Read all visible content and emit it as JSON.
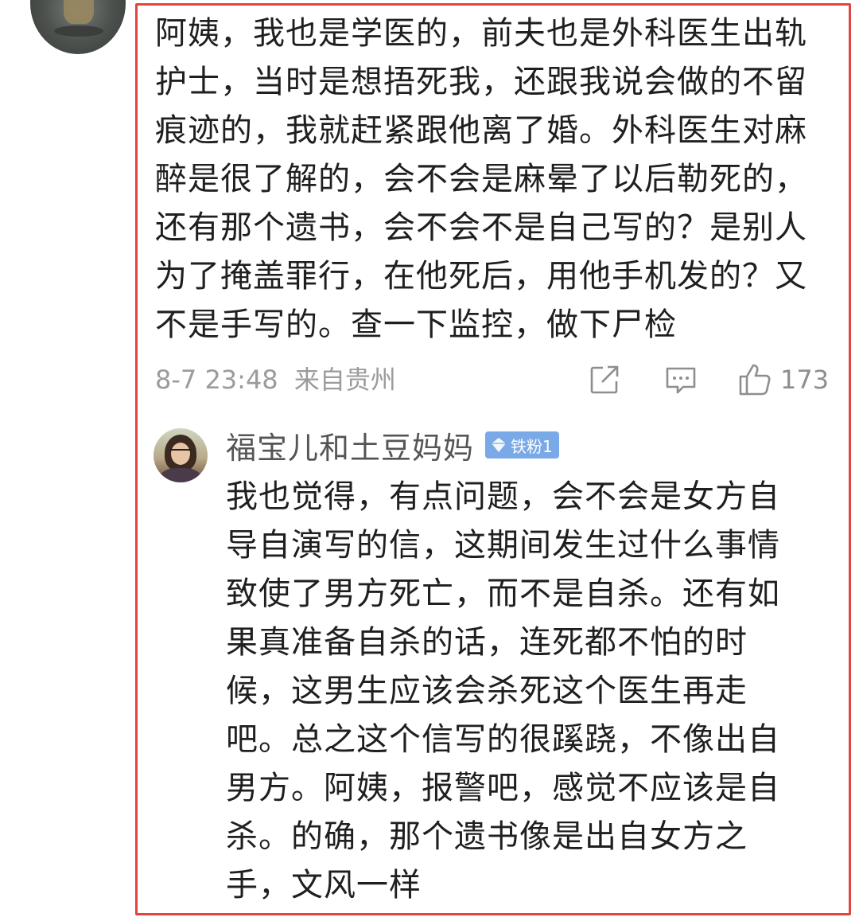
{
  "top_comment": {
    "text": "阿姨，我也是学医的，前夫也是外科医生出轨护士，当时是想捂死我，还跟我说会做的不留痕迹的，我就赶紧跟他离了婚。外科医生对麻醉是很了解的，会不会是麻晕了以后勒死的，还有那个遗书，会不会不是自己写的？是别人为了掩盖罪行，在他死后，用他手机发的？又不是手写的。查一下监控，做下尸检",
    "timestamp": "8-7 23:48",
    "location": "来自贵州",
    "like_count": "173",
    "icons": {
      "share": "share-icon",
      "comment": "comment-icon",
      "like": "thumbs-up-icon"
    }
  },
  "reply": {
    "username": "福宝儿和土豆妈妈",
    "badge": "铁粉1",
    "badge_icon": "diamond-icon",
    "text": "我也觉得，有点问题，会不会是女方自导自演写的信，这期间发生过什么事情致使了男方死亡，而不是自杀。还有如果真准备自杀的话，连死都不怕的时候，这男生应该会杀死这个医生再走吧。总之这个信写的很蹊跷，不像出自男方。阿姨，报警吧，感觉不应该是自杀。的确，那个遗书像是出自女方之手，文风一样"
  },
  "colors": {
    "highlight_border": "#e0453f",
    "meta_text": "#9b9b9b",
    "badge_bg": "#7aa9e8"
  }
}
